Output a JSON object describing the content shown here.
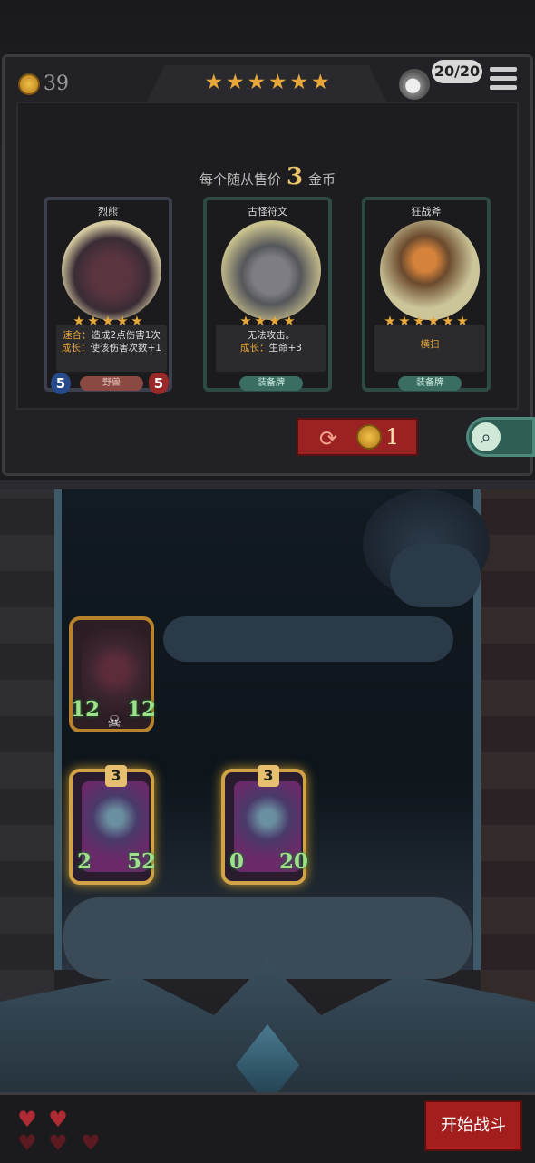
{
  "header": {
    "gold": "39",
    "tavern_stars": 6,
    "xp": "20/20"
  },
  "shop": {
    "price_prefix": "每个随从售价",
    "price_value": "3",
    "price_suffix": "金币",
    "cards": [
      {
        "name": "烈熊",
        "stars": 5,
        "desc_line1_label": "速合：",
        "desc_line1_text": "造成2点伤害1次",
        "desc_line2_label": "成长：",
        "desc_line2_text": "使该伤害次数+1",
        "tag": "野兽",
        "attack": "5",
        "health": "5"
      },
      {
        "name": "古怪符文",
        "stars": 4,
        "desc_line1_label": "",
        "desc_line1_text": "无法攻击。",
        "desc_line2_label": "成长：",
        "desc_line2_text": "生命+3",
        "tag": "装备牌"
      },
      {
        "name": "狂战斧",
        "stars": 6,
        "desc_line1_label": "",
        "desc_line1_text": "横扫",
        "desc_line2_label": "",
        "desc_line2_text": "",
        "tag": "装备牌"
      }
    ],
    "refresh_cost": "1"
  },
  "board": {
    "minions": [
      {
        "attack": "12",
        "health": "12",
        "tier": ""
      },
      {
        "attack": "2",
        "health": "52",
        "tier": "3"
      },
      {
        "attack": "0",
        "health": "20",
        "tier": "3"
      }
    ]
  },
  "footer": {
    "lives_total": 5,
    "lives_full": 2,
    "start_label": "开始战斗"
  },
  "colors": {
    "gold": "#e7a73a",
    "button_red": "#a51e1e",
    "stat_green": "#9fe08a"
  }
}
